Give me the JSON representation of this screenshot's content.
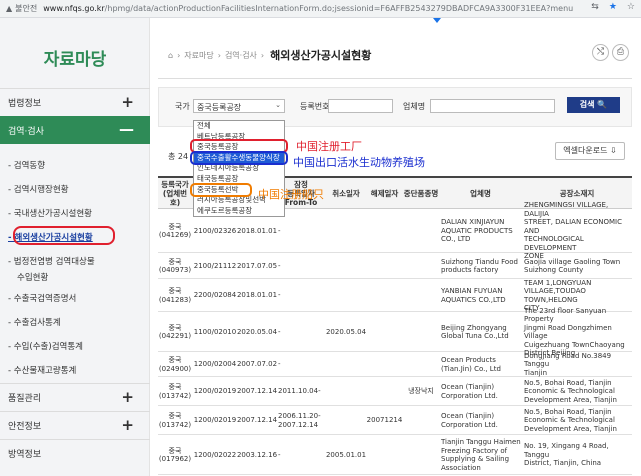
{
  "browser": {
    "security_label": "불안전",
    "url_host": "www.nfqs.go.kr",
    "url_path": "/hpmg/data/actionProductionFacilitiesInternationForm.do;jsessionid=F6AFFB2543279DBADFCA9A3300F31EEA?menuId=M0000221",
    "zoom_icon": "translate-icon",
    "colors": {
      "bar": "#f1f3f4",
      "star": "#1a73e8"
    }
  },
  "sidebar": {
    "title": "자료마당",
    "sections": [
      {
        "label": "법령정보",
        "expand": "+"
      },
      {
        "label": "검역·검사",
        "expand": "—",
        "active": true
      },
      {
        "label": "품질관리",
        "expand": "+"
      },
      {
        "label": "안전정보",
        "expand": "+"
      },
      {
        "label": "방역정보",
        "expand": ""
      }
    ],
    "subitems": [
      {
        "label": "검역동향"
      },
      {
        "label": "검역시행장현황"
      },
      {
        "label": "국내생산가공시설현황"
      },
      {
        "label": "해외생산가공시설현황",
        "current": true
      },
      {
        "label": "법정전염병 검역대상물",
        "label2": "수입현황"
      },
      {
        "label": "수출국검역증명서"
      },
      {
        "label": "수출검사통계"
      },
      {
        "label": "수입(수출)검역통계"
      },
      {
        "label": "수산물재고량통계"
      }
    ]
  },
  "breadcrumb": {
    "home_icon": "home-icon",
    "items": [
      "자료마당",
      "검역·검사"
    ],
    "current": "해외생산가공시설현황"
  },
  "toolbar": {
    "share_icon": "share-icon",
    "print_icon": "print-icon"
  },
  "search": {
    "country_label": "국가",
    "country_value": "중국등록공장",
    "reg_label": "등록번호",
    "company_label": "업체명",
    "button_label": "검색 🔍"
  },
  "dropdown": {
    "options": [
      "전체",
      "베트남등록공장",
      "중국등록공장",
      "중국수출활수생동물양식장",
      "인도네시아등록공장",
      "태국등록공장",
      "중국등록선박",
      "러시아등록공장및선박",
      "에쿠도르등록공장"
    ],
    "selected_index": 2
  },
  "total_text": "총 24",
  "excel_label": "엑셀다운로드 ⇩",
  "annotations": {
    "a1": "中国注册工厂",
    "a2": "中国出口活水生动物养殖场",
    "a3": "中国注册船只",
    "colors": {
      "red": "#e0202e",
      "blue": "#1a2ecf",
      "orange": "#f07c00"
    }
  },
  "table": {
    "headers": [
      "등록국가\n(업체번호)",
      "등록번호",
      "등록일자",
      "잠정\n등록일자\nFrom-To",
      "취소일자",
      "해제일자",
      "중단품종명",
      "업체명",
      "공장소재지"
    ],
    "rows": [
      [
        "중국\n(041269)",
        "2100/02326",
        "2018.01.01",
        "-",
        "",
        "",
        "",
        "DALIAN XINJIAYUN\nAQUATIC PRODUCTS\nCO., LTD",
        "ZHENGMINGSI VILLAGE, DALIJIA\nSTREET, DALIAN ECONOMIC AND\nTECHNOLOGICAL DEVELOPMENT\nZONE"
      ],
      [
        "중국\n(040973)",
        "2100/21112",
        "2017.07.05",
        "-",
        "",
        "",
        "",
        "Suizhong Tiandu Food\nproducts factory",
        "Gaojia village Gaoling Town\nSuizhong County"
      ],
      [
        "중국\n(041283)",
        "2200/02084",
        "2018.01.01",
        "-",
        "",
        "",
        "",
        "YANBIAN FUYUAN\nAQUATICS CO.,LTD",
        "TEAM 1,LONGYUAN\nVILLAGE,TOUDAO TOWN,HELONG\nCITY"
      ],
      [
        "중국\n(042291)",
        "1100/02010",
        "2020.05.04",
        "-",
        "2020.05.04",
        "",
        "",
        "Beijing Zhongyang\nGlobal Tuna Co.,Ltd",
        "The 23rd floor Sanyuan Property\nJingmi Road Dongzhimen Village\nCuigezhuang TownChaoyang\nDistrict Beijing"
      ],
      [
        "중국\n(024900)",
        "1200/02004",
        "2007.07.02",
        "-",
        "",
        "",
        "",
        "Ocean Products\n(Tian.Jin) Co., Ltd",
        "Dongjiang Road No.3849 Tanggu\nTianjin"
      ],
      [
        "중국\n(013742)",
        "1200/02019",
        "2007.12.14",
        "2011.10.04-",
        "",
        "",
        "냉장낙지",
        "Ocean (Tianjin)\nCorporation Ltd.",
        "No.5, Bohai Road, Tianjin\nEconomic & Technological\nDevelopment Area, Tianjin"
      ],
      [
        "중국\n(013742)",
        "1200/02019",
        "2007.12.14",
        "2006.11.20-\n2007.12.14",
        "",
        "20071214",
        "",
        "Ocean (Tianjin)\nCorporation Ltd.",
        "No.5, Bohai Road, Tianjin\nEconomic & Technological\nDevelopment Area, Tianjin"
      ],
      [
        "중국\n(017962)",
        "1200/02022",
        "2003.12.16",
        "-",
        "2005.01.01",
        "",
        "",
        "Tianjin Tanggu Haimen\nFreezing Factory of\nSupplying & Sailing\nAssociation",
        "No. 19, Xingang 4 Road, Tanggu\nDistrict, Tianjin, China"
      ]
    ]
  }
}
